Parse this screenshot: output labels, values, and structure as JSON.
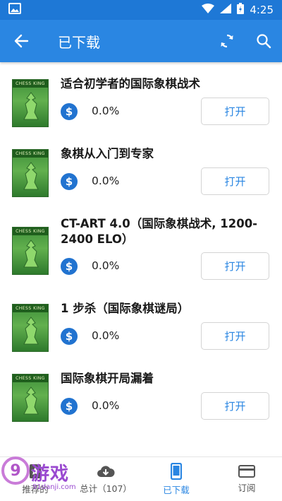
{
  "status_bar": {
    "time": "4:25"
  },
  "app_bar": {
    "title": "已下载"
  },
  "items": [
    {
      "title": "适合初学者的国际象棋战术",
      "progress": "0.0%",
      "button": "打开"
    },
    {
      "title": "象棋从入门到专家",
      "progress": "0.0%",
      "button": "打开"
    },
    {
      "title": "CT-ART 4.0（国际象棋战术, 1200-2400 ELO）",
      "progress": "0.0%",
      "button": "打开"
    },
    {
      "title": "1 步杀（国际象棋谜局）",
      "progress": "0.0%",
      "button": "打开"
    },
    {
      "title": "国际象棋开局漏着",
      "progress": "0.0%",
      "button": "打开"
    }
  ],
  "cover": {
    "header": "CHESS KING"
  },
  "price_icon": "$",
  "bottom_nav": [
    {
      "label": "推荐的",
      "icon": "featured-icon",
      "active": false
    },
    {
      "label": "总计（107）",
      "icon": "cloud-download-icon",
      "active": false
    },
    {
      "label": "已下载",
      "icon": "phone-icon",
      "active": true
    },
    {
      "label": "订阅",
      "icon": "card-icon",
      "active": false
    }
  ],
  "watermark": {
    "logo": "9",
    "text": "游戏",
    "sub": "91danji.com"
  },
  "colors": {
    "primary": "#2a86e2",
    "status_bar": "#1e78d6",
    "price_icon": "#2173d0"
  }
}
